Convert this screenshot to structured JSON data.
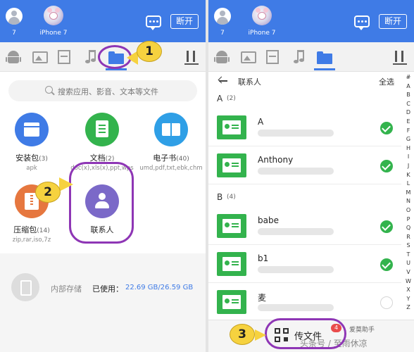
{
  "header": {
    "my_id": "7",
    "device_name": "iPhone 7",
    "disconnect_label": "断开"
  },
  "left": {
    "search_placeholder": "搜索应用、影音、文本等文件",
    "categories": [
      {
        "label": "安装包",
        "count": "(3)",
        "sub": "apk"
      },
      {
        "label": "文档",
        "count": "(2)",
        "sub": "doc(x),xls(x),ppt,wps"
      },
      {
        "label": "电子书",
        "count": "(40)",
        "sub": "umd,pdf,txt,ebk,chm"
      },
      {
        "label": "压缩包",
        "count": "(14)",
        "sub": "zip,rar,iso,7z"
      },
      {
        "label": "联系人",
        "count": "",
        "sub": ""
      }
    ],
    "storage": {
      "label": "内部存储",
      "used_label": "已使用：",
      "used_value": "22.69 GB/26.59 GB"
    }
  },
  "right": {
    "title": "联系人",
    "select_all": "全选",
    "sections": [
      {
        "letter": "A",
        "count": "(2)"
      },
      {
        "letter": "B",
        "count": "(4)"
      }
    ],
    "contacts": [
      {
        "name": "A",
        "checked": true
      },
      {
        "name": "Anthony",
        "checked": true
      },
      {
        "name": "babe",
        "checked": true
      },
      {
        "name": "b1",
        "checked": true
      },
      {
        "name": "麦",
        "checked": false
      }
    ],
    "alphabet": [
      "#",
      "A",
      "B",
      "C",
      "D",
      "E",
      "F",
      "G",
      "H",
      "I",
      "J",
      "K",
      "L",
      "M",
      "N",
      "O",
      "P",
      "Q",
      "R",
      "S",
      "T",
      "U",
      "V",
      "W",
      "X",
      "Y",
      "Z"
    ],
    "send_label": "传文件",
    "send_count": "4"
  },
  "annotations": {
    "step1": "1",
    "step2": "2",
    "step3": "3",
    "ring_color": "#8e36b5",
    "badge_color": "#f6d23f"
  },
  "watermark": {
    "line1": "爱莫助手",
    "line2": "头条号 / 至雨休凉"
  },
  "colors": {
    "header": "#3f7be6",
    "accent_green": "#33b34d",
    "badge_red": "#e94b4b"
  }
}
